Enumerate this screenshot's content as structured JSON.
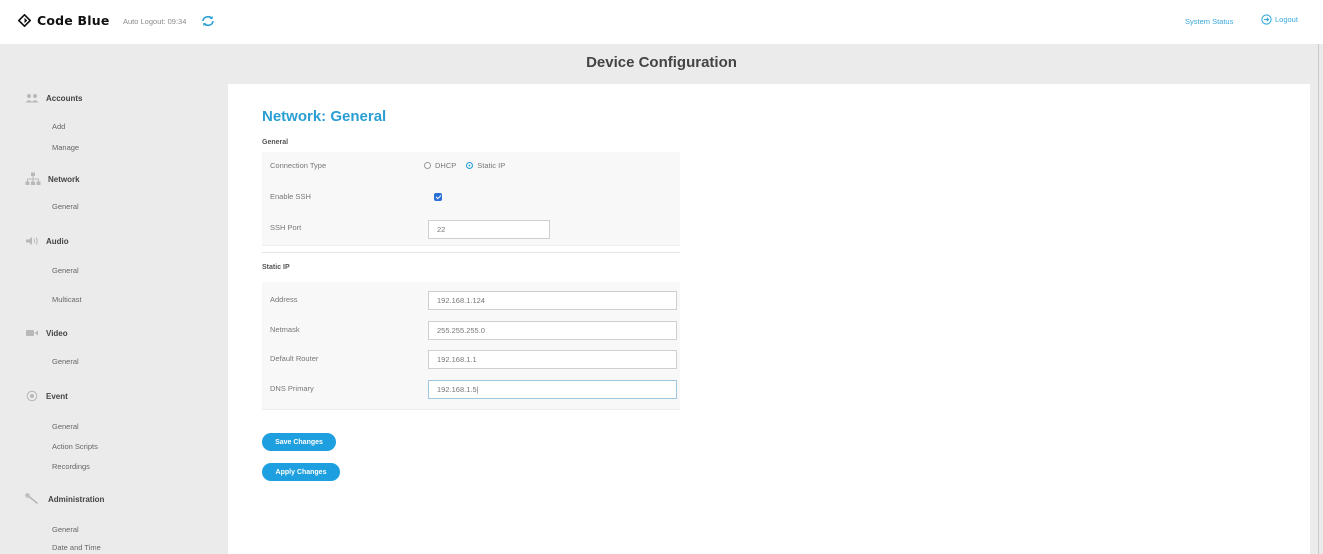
{
  "app": {
    "logo_text": "Code Blue",
    "auto_logout": "Auto Logout: 09:34",
    "system_status": "System Status",
    "logout": "Logout"
  },
  "header": {
    "title": "Device Configuration"
  },
  "sidebar": {
    "sections": [
      {
        "label": "Accounts",
        "icon": "users-icon",
        "items": [
          "Add",
          "Manage"
        ]
      },
      {
        "label": "Network",
        "icon": "network-icon",
        "items": [
          "General"
        ]
      },
      {
        "label": "Audio",
        "icon": "speaker-icon",
        "items": [
          "General",
          "Multicast"
        ]
      },
      {
        "label": "Video",
        "icon": "video-camera-icon",
        "items": [
          "General"
        ]
      },
      {
        "label": "Event",
        "icon": "event-icon",
        "items": [
          "General",
          "Action Scripts",
          "Recordings"
        ]
      },
      {
        "label": "Administration",
        "icon": "wrench-icon",
        "items": [
          "General",
          "Date and Time"
        ]
      }
    ]
  },
  "main": {
    "title": "Network: General",
    "general": {
      "heading": "General",
      "connection_type_label": "Connection Type",
      "connection_options": [
        "DHCP",
        "Static IP"
      ],
      "connection_selected": "Static IP",
      "enable_ssh_label": "Enable SSH",
      "enable_ssh_checked": true,
      "ssh_port_label": "SSH Port",
      "ssh_port_value": "22"
    },
    "static_ip": {
      "heading": "Static IP",
      "address_label": "Address",
      "address_value": "192.168.1.124",
      "netmask_label": "Netmask",
      "netmask_value": "255.255.255.0",
      "router_label": "Default Router",
      "router_value": "192.168.1.1",
      "dns_label": "DNS Primary",
      "dns_value": "192.168.1.5|"
    },
    "buttons": {
      "save": "Save Changes",
      "apply": "Apply Changes"
    }
  },
  "colors": {
    "accent": "#2b9fd3",
    "button": "#1e9fe0",
    "sidebar_bg": "#ebebeb"
  }
}
